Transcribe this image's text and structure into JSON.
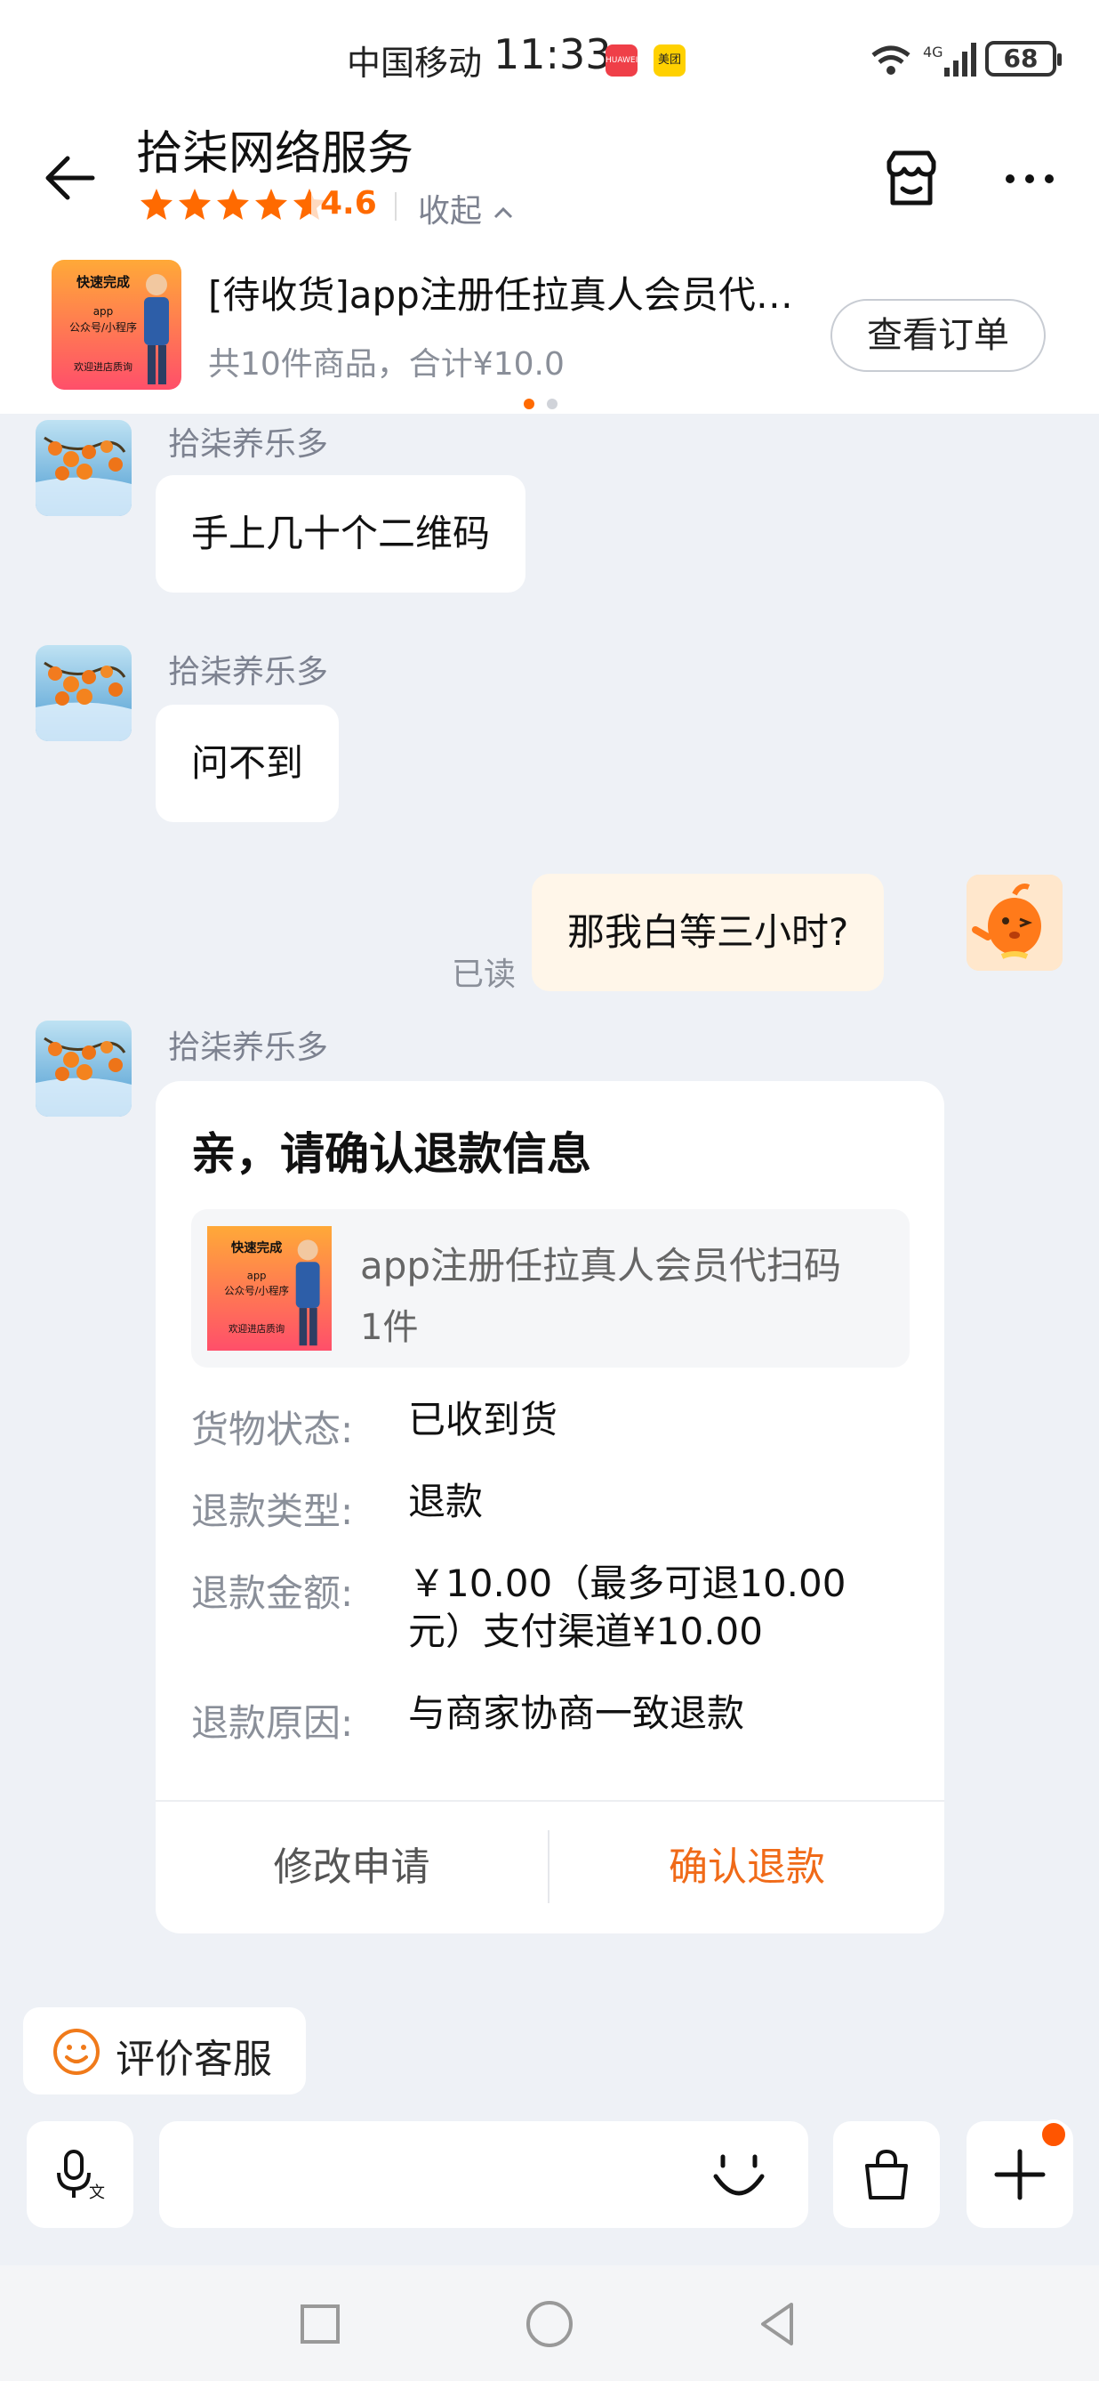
{
  "status_bar": {
    "carrier": "中国移动",
    "time": "11:33",
    "app1_label": "HUAWEI",
    "app2_label": "美团",
    "network": "4G",
    "battery": "68"
  },
  "header": {
    "shop_name": "拾柒网络服务",
    "rating": "4.6",
    "rating_stars": 4.6,
    "collapse_label": "收起",
    "accent_color": "#ff6a00"
  },
  "order": {
    "title": "[待收货]app注册任拉真人会员代扫码",
    "summary": "共10件商品，合计¥10.0",
    "view_button": "查看订单",
    "thumb_texts": [
      "快速完成",
      "app",
      "公众号/小程序",
      "欢迎进店质询"
    ],
    "carousel_count": 2,
    "carousel_active": 1
  },
  "messages": [
    {
      "sender": "拾柒养乐多",
      "text": "手上几十个二维码"
    },
    {
      "sender": "拾柒养乐多",
      "text": "问不到"
    },
    {
      "sender": "me",
      "text": "那我白等三小时?",
      "read_status": "已读"
    }
  ],
  "refund_card": {
    "sender": "拾柒养乐多",
    "title": "亲，请确认退款信息",
    "product_name": "app注册任拉真人会员代扫码",
    "quantity": "1件",
    "rows": [
      {
        "label": "货物状态:",
        "value": "已收到货"
      },
      {
        "label": "退款类型:",
        "value": "退款"
      },
      {
        "label": "退款金额:",
        "value": "￥10.00（最多可退10.00元）支付渠道¥10.00"
      },
      {
        "label": "退款原因:",
        "value": "与商家协商一致退款"
      }
    ],
    "modify_button": "修改申请",
    "confirm_button": "确认退款",
    "confirm_color": "#f06a18"
  },
  "rate_service": {
    "label": "评价客服"
  },
  "input_bar": {
    "voice_icon": "microphone-translate-icon",
    "emoji_icon": "smile-icon",
    "bag_icon": "shopping-bag-icon",
    "plus_icon": "plus-icon"
  },
  "system_nav": [
    "square-icon",
    "circle-home-icon",
    "triangle-back-icon"
  ]
}
